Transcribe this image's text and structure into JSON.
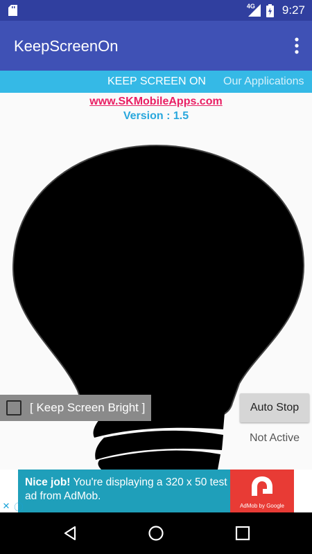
{
  "status_bar": {
    "network_label": "4G",
    "time": "9:27",
    "icons": [
      "sd-card-icon",
      "signal-icon",
      "battery-icon"
    ]
  },
  "app_bar": {
    "title": "KeepScreenOn",
    "menu_icon": "overflow-menu-icon"
  },
  "tabs": [
    {
      "label": "KEEP SCREEN ON",
      "active": true
    },
    {
      "label": "Our Applications",
      "active": false
    }
  ],
  "main": {
    "website": "www.SKMobileApps.com",
    "version": "Version : 1.5",
    "bulb_icon": "lightbulb-icon",
    "checkbox": {
      "label": "[ Keep Screen Bright ]",
      "checked": false
    },
    "auto_stop_label": "Auto Stop",
    "status": "Not Active"
  },
  "ad": {
    "headline": "Nice job!",
    "text": " You're displaying a 320 x 50 test ad from AdMob.",
    "logo_caption": "AdMob by Google",
    "choices_icons": [
      "close-icon",
      "info-icon"
    ]
  },
  "nav_bar": {
    "buttons": [
      "back-icon",
      "home-icon",
      "recents-icon"
    ]
  },
  "colors": {
    "status_bar": "#303f9f",
    "app_bar": "#3f51b5",
    "tab_bar": "#35b9e6",
    "link": "#e91e63",
    "version": "#29a7dd",
    "ad_background": "#1f9fba",
    "ad_logo": "#e83b35"
  }
}
